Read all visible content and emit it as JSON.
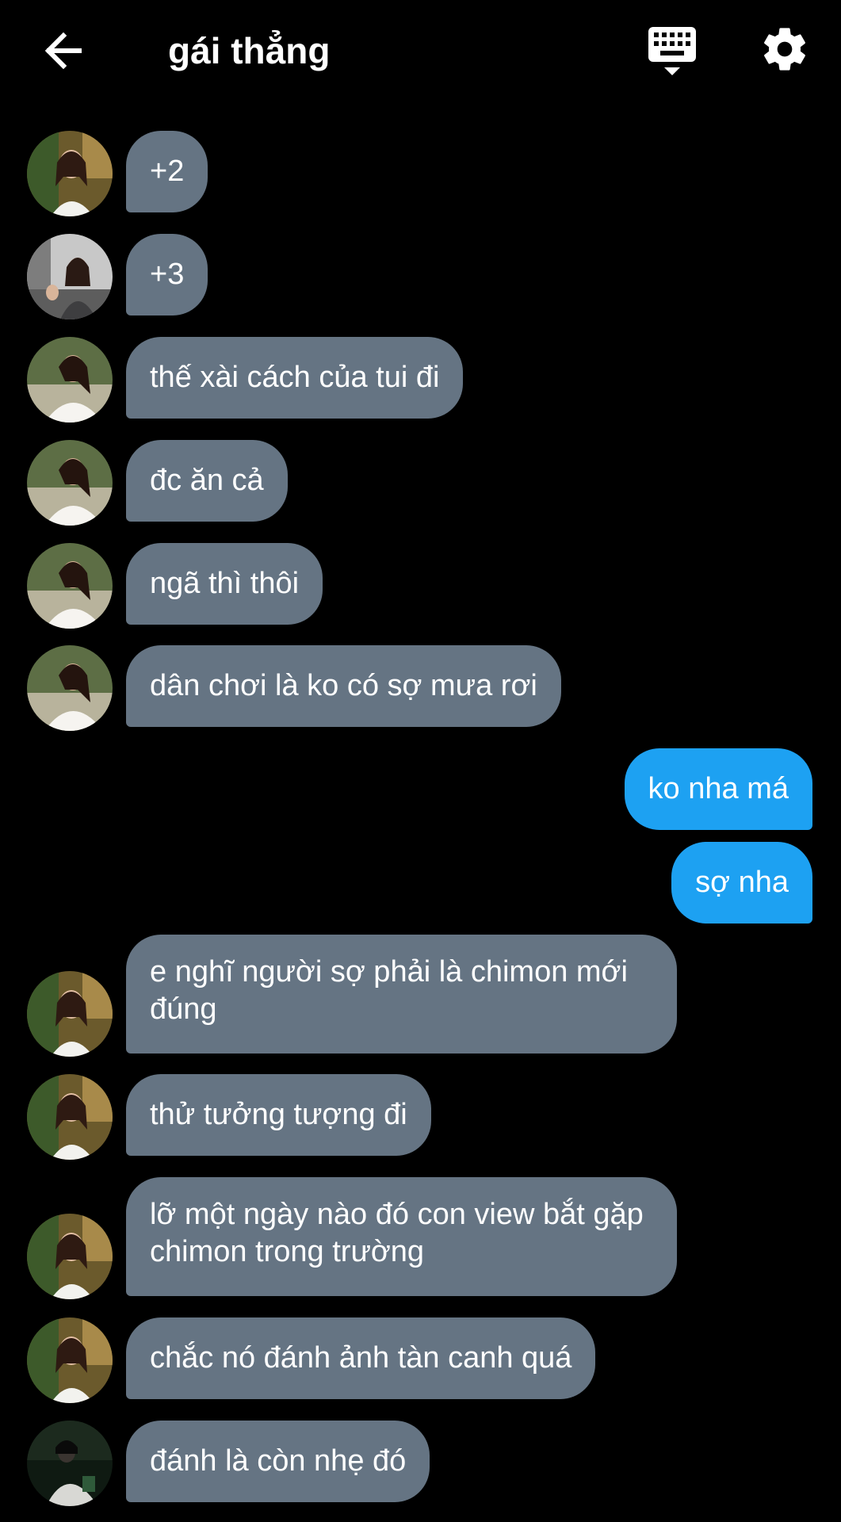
{
  "header": {
    "title": "gái thẳng",
    "back_icon": "arrow-left-icon",
    "keyboard_icon": "keyboard-icon",
    "settings_icon": "gear-icon"
  },
  "colors": {
    "background": "#000000",
    "incoming_bubble": "#657483",
    "outgoing_bubble": "#1da1f2",
    "text": "#ffffff"
  },
  "messages": [
    {
      "direction": "in",
      "avatar": "avatar-girl-cafe",
      "text": "+2"
    },
    {
      "direction": "in",
      "avatar": "avatar-girl-street",
      "text": "+3"
    },
    {
      "direction": "in",
      "avatar": "avatar-girl-white-top",
      "text": "thế xài cách của tui đi"
    },
    {
      "direction": "in",
      "avatar": "avatar-girl-white-top",
      "text": "đc ăn cả"
    },
    {
      "direction": "in",
      "avatar": "avatar-girl-white-top",
      "text": "ngã thì thôi"
    },
    {
      "direction": "in",
      "avatar": "avatar-girl-white-top",
      "text": "dân chơi là ko có sợ mưa rơi"
    },
    {
      "direction": "out",
      "text": "ko nha má"
    },
    {
      "direction": "out",
      "text": "sợ nha"
    },
    {
      "direction": "in",
      "avatar": "avatar-girl-cafe",
      "text": "e nghĩ người sợ phải là chimon mới đúng"
    },
    {
      "direction": "in",
      "avatar": "avatar-girl-cafe",
      "text": "thử tưởng tượng đi"
    },
    {
      "direction": "in",
      "avatar": "avatar-girl-cafe",
      "text": "lỡ một ngày nào đó con view bắt gặp chimon trong trường"
    },
    {
      "direction": "in",
      "avatar": "avatar-girl-cafe",
      "text": "chắc nó đánh ảnh tàn canh quá"
    },
    {
      "direction": "in",
      "avatar": "avatar-person-dark",
      "text": "đánh là còn nhẹ đó"
    }
  ]
}
